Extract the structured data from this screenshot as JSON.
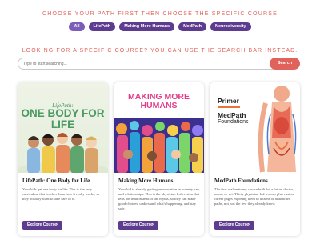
{
  "header": {
    "path_title": "CHOOSE YOUR PATH FIRST THEN CHOOSE THE SPECIFIC COURSE",
    "filters": [
      "All",
      "LifePath",
      "Making More Humans",
      "MedPath",
      "Neurodiversity"
    ]
  },
  "search": {
    "title": "LOOKING FOR A SPECIFIC COURSE? YOU CAN USE THE SEARCH BAR INSTEAD.",
    "placeholder": "Type to start searching...",
    "button": "Search"
  },
  "cards": [
    {
      "image": {
        "brand": "LifePath:",
        "headline": "ONE BODY FOR LIFE"
      },
      "title": "LifePath: One Body for Life",
      "description": "Your kids get one body for life. This is the only curriculum that teaches them how it really works, so they actually want to take care of it.",
      "button": "Explore Course"
    },
    {
      "image": {
        "headline": "MAKING MORE HUMANS"
      },
      "title": "Making More Humans",
      "description": "Your kid is already getting an education in puberty, sex, and relationships. This is the physician-led version that tells the truth instead of the myths, so they can make good choices, understand what's happening, and stay safe.",
      "button": "Explore Course"
    },
    {
      "image": {
        "primer": "Primer",
        "brand": "MedPath",
        "sub": "Foundations"
      },
      "title": "MedPath Foundations",
      "description": "The first real anatomy course built for a future doctor, nurse, or vet. Thirty physician-led lessons plus custom career pages exposing them to dozens of healthcare paths, not just the few they already know.",
      "button": "Explore Course"
    }
  ],
  "colors": {
    "accent": "#e0625a",
    "brand_purple": "#5d3b8f"
  }
}
